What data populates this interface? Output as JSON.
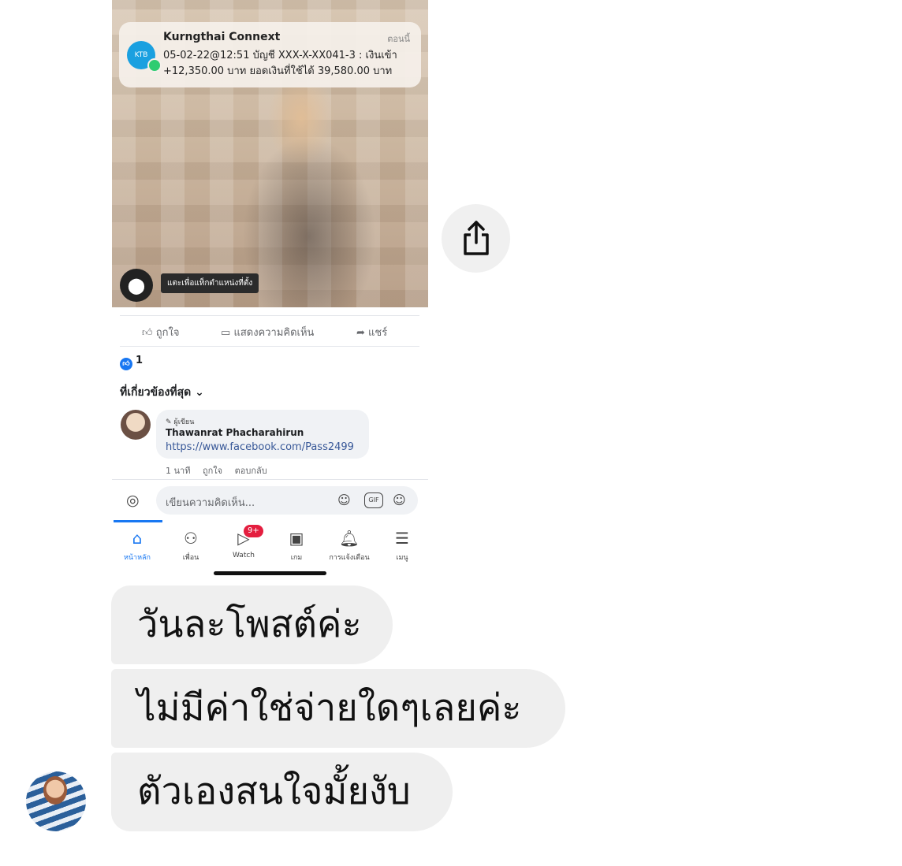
{
  "notification": {
    "app": "Kurngthai Connext",
    "time": "ตอนนี้",
    "line1": "05-02-22@12:51 บัญชี XXX-X-XX041-3 : เงินเข้า",
    "line2": "+12,350.00 บาท ยอดเงินที่ใช้ได้ 39,580.00 บาท"
  },
  "location": {
    "tooltip": "แตะเพื่อแท็กตำแหน่งที่ตั้ง"
  },
  "actions": {
    "like": "ถูกใจ",
    "comment": "แสดงความคิดเห็น",
    "share": "แชร์"
  },
  "like_count": "1",
  "relevant_label": "ที่เกี่ยวข้องที่สุด",
  "comment": {
    "role": "ผู้เขียน",
    "author": "Thawanrat Phacharahirun",
    "link": "https://www.facebook.com/Pass2499",
    "time": "1 นาที",
    "like": "ถูกใจ",
    "reply": "ตอบกลับ"
  },
  "input": {
    "placeholder": "เขียนความคิดเห็น..."
  },
  "tabs": [
    {
      "label": "หน้าหลัก",
      "icon": "home-icon"
    },
    {
      "label": "เพื่อน",
      "icon": "friends-icon"
    },
    {
      "label": "Watch",
      "icon": "watch-icon",
      "badge": "9+"
    },
    {
      "label": "เกม",
      "icon": "gaming-icon"
    },
    {
      "label": "การแจ้งเตือน",
      "icon": "bell-icon"
    },
    {
      "label": "เมนู",
      "icon": "menu-icon"
    }
  ],
  "messages": [
    {
      "text": "วันละโพสต์ค่ะ"
    },
    {
      "text": "ไม่มีค่าใช่จ่ายใดๆเลยค่ะ"
    },
    {
      "text": "ตัวเองสนใจมั้ยงับ"
    }
  ],
  "colors": {
    "accent": "#1877f2",
    "bubble": "#efefef",
    "badge": "#e41e3f"
  }
}
